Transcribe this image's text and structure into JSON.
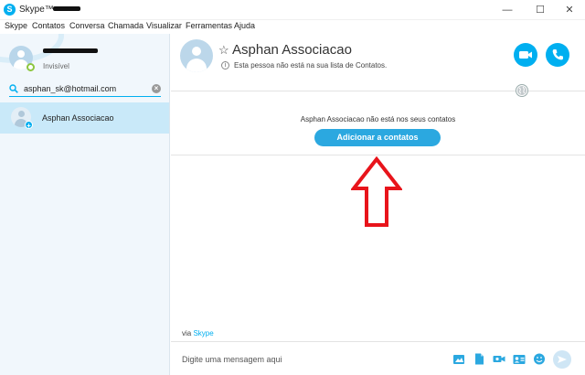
{
  "window": {
    "title": "Skype™ -",
    "minimize_glyph": "—",
    "maximize_glyph": "☐",
    "close_glyph": "✕"
  },
  "menu": {
    "items": [
      "Skype",
      "Contatos",
      "Conversa",
      "Chamada",
      "Visualizar",
      "Ferramentas",
      "Ajuda"
    ]
  },
  "sidebar": {
    "profile_status": "Invisível",
    "search_value": "asphan_sk@hotmail.com",
    "search_clear_glyph": "×",
    "contacts": [
      {
        "name": "Asphan Associacao",
        "badge_glyph": "+"
      }
    ]
  },
  "conversation": {
    "star_glyph": "☆",
    "contact_name": "Asphan Associacao",
    "info_glyph": "i",
    "not_in_list_text": "Esta pessoa não está na sua lista de Contatos.",
    "notice_text": "Asphan Associacao não está nos seus contatos",
    "add_button_label": "Adicionar a contatos",
    "via_prefix": "via",
    "via_link": "Skype",
    "compose_placeholder": "Digite uma mensagem aqui"
  },
  "colors": {
    "accent": "#00aff0",
    "button_blue": "#2ba8e0",
    "selected_row": "#c9e9f9",
    "sidebar_bg": "#f1f7fc",
    "arrow_red": "#e8141b",
    "presence_green": "#8dc63f"
  },
  "icons": {
    "header": [
      "video-call-icon",
      "phone-call-icon",
      "globe-icon"
    ],
    "compose_tools": [
      "image-icon",
      "file-icon",
      "video-message-icon",
      "contact-card-icon",
      "emoticon-icon",
      "send-icon"
    ]
  }
}
